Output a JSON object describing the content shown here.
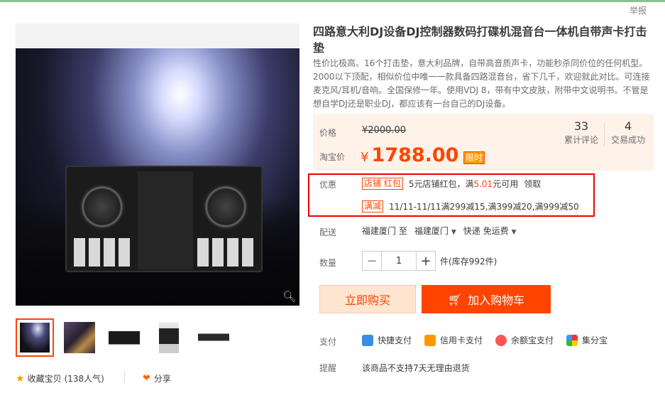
{
  "top": {
    "report": "举报"
  },
  "product": {
    "title": "四路意大利DJ设备DJ控制器数码打碟机混音台一体机自带声卡打击垫",
    "description": "性价比极高。16个打击垫，意大利品牌，自带高音质声卡，功能秒杀同价位的任何机型。2000以下顶配，相似价位中唯一一款具备四路混音台，省下几千，欢迎就此对比。可连接麦克风/耳机/音响。全国保修一年。使用VDJ 8，带有中文皮肤，附带中文说明书。不管是想自学DJ还是职业DJ，都应该有一台自己的DJ设备。"
  },
  "price": {
    "label": "价格",
    "original": "¥2000.00",
    "promo_label": "淘宝价",
    "currency": "¥",
    "current": "1788.00",
    "time_badge": "限时"
  },
  "stats": {
    "reviews_count": "33",
    "reviews_label": "累计评论",
    "sales_count": "4",
    "sales_label": "交易成功"
  },
  "promotions": {
    "label": "优惠",
    "coupon_tag": "店铺 红包",
    "coupon_text_a": "5元店铺红包，满",
    "coupon_text_hl": "5.01",
    "coupon_text_b": "元可用",
    "claim": "领取",
    "discount_tag": "满减",
    "discount_text": "11/11-11/11满299减15,满399减20,满999减50"
  },
  "shipping": {
    "label": "配送",
    "from": "福建厦门 至",
    "to": "福建厦门",
    "method": "快递 免运费"
  },
  "quantity": {
    "label": "数量",
    "minus": "−",
    "value": "1",
    "plus": "+",
    "stock": "件(库存992件)"
  },
  "actions": {
    "buy_now": "立即购买",
    "add_to_cart": "加入购物车"
  },
  "payment": {
    "label": "支付",
    "methods": [
      "快捷支付",
      "信用卡支付",
      "余额宝支付",
      "集分宝"
    ]
  },
  "reminder": {
    "label": "提醒",
    "text": "该商品不支持7天无理由退货"
  },
  "gallery": {
    "favorite": "收藏宝贝",
    "favorite_count": "(138人气)",
    "share": "分享"
  },
  "colors": {
    "accent": "#ff4400",
    "price_bg": "#fff2e8",
    "highlight_box": "#e00000"
  },
  "icons": [
    "star-icon",
    "share-icon",
    "zoom-icon",
    "cart-icon",
    "quickpay-icon",
    "creditcard-icon",
    "yuebao-icon",
    "jifenbao-icon",
    "caret-down-icon"
  ]
}
